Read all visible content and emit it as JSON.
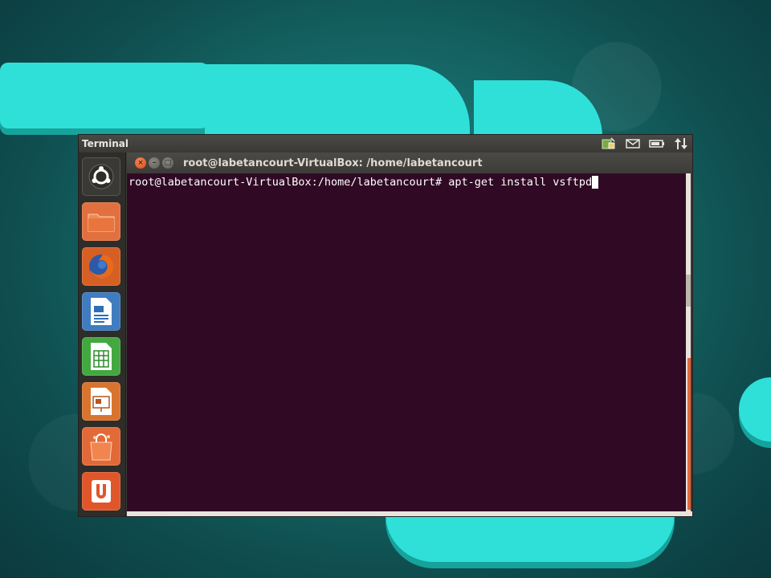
{
  "top_panel": {
    "app_title": "Terminal"
  },
  "indicators": [
    {
      "icon": "network-icon"
    },
    {
      "icon": "mail-icon"
    },
    {
      "icon": "battery-icon"
    },
    {
      "icon": "sync-arrows-icon"
    }
  ],
  "launcher": {
    "items": [
      {
        "name": "dash-home",
        "icon": "ubuntu-logo-icon",
        "color": "#3a3936"
      },
      {
        "name": "files",
        "icon": "folder-icon",
        "color": "#e06a3c"
      },
      {
        "name": "firefox",
        "icon": "firefox-icon",
        "color": "#c8581c"
      },
      {
        "name": "libreoffice-writer",
        "icon": "writer-icon",
        "color": "#2d6fb7"
      },
      {
        "name": "libreoffice-calc",
        "icon": "calc-icon",
        "color": "#3da13a"
      },
      {
        "name": "libreoffice-impress",
        "icon": "impress-icon",
        "color": "#d66e2c"
      },
      {
        "name": "software-center",
        "icon": "shopping-bag-icon",
        "color": "#e06a3c"
      },
      {
        "name": "ubuntu-one",
        "icon": "ubuntu-one-icon",
        "color": "#e05a28"
      }
    ]
  },
  "window": {
    "title": "root@labetancourt-VirtualBox: /home/labetancourt",
    "close_glyph": "×",
    "minimize_glyph": "–",
    "maximize_glyph": "□"
  },
  "terminal": {
    "prompt": "root@labetancourt-VirtualBox:/home/labetancourt# ",
    "command": "apt-get install vsftpd",
    "background": "#300a24"
  }
}
